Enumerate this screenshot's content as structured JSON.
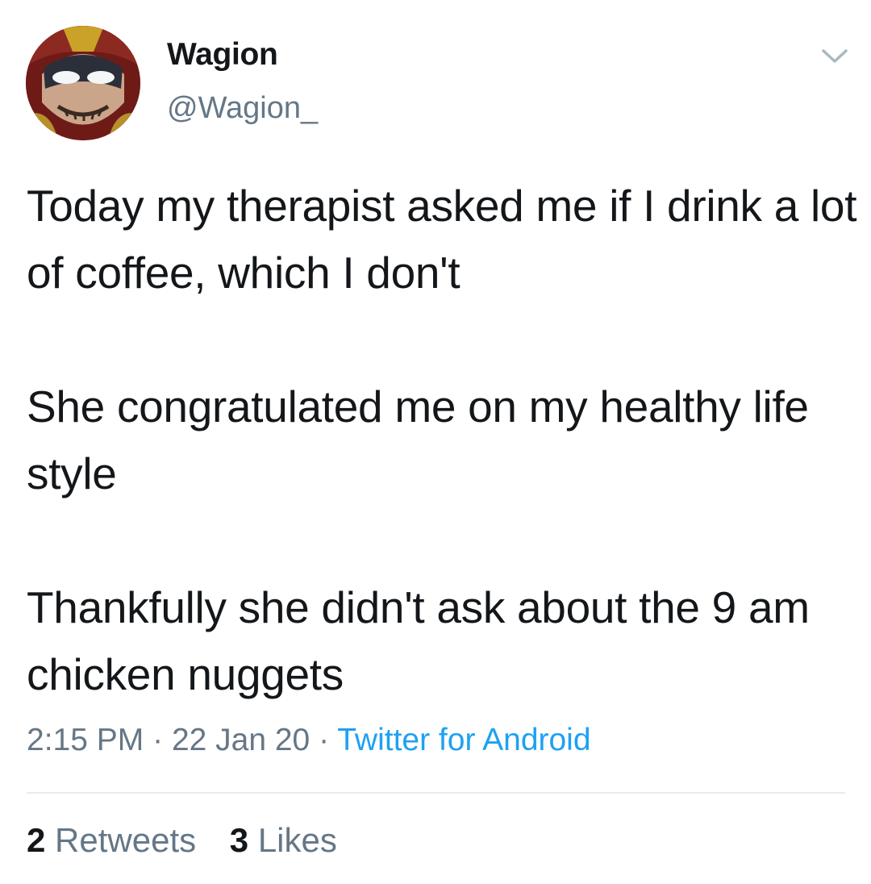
{
  "user": {
    "display_name": "Wagion",
    "handle": "@Wagion_",
    "avatar_icon": "profile-avatar"
  },
  "tweet": {
    "paragraphs": [
      "Today my therapist asked me if I drink a lot of coffee, which I don't",
      "She congratulated me on my healthy life style",
      "Thankfully she didn't ask about the 9 am chicken nuggets"
    ]
  },
  "meta": {
    "time": "2:15 PM",
    "separator": "·",
    "date": "22 Jan 20",
    "source": "Twitter for Android"
  },
  "stats": {
    "retweets_count": "2",
    "retweets_label": "Retweets",
    "likes_count": "3",
    "likes_label": "Likes"
  },
  "colors": {
    "text": "#14171a",
    "secondary": "#657786",
    "link": "#1da1f2",
    "divider": "#e6ecf0"
  },
  "icons": {
    "menu": "chevron-down-icon"
  }
}
